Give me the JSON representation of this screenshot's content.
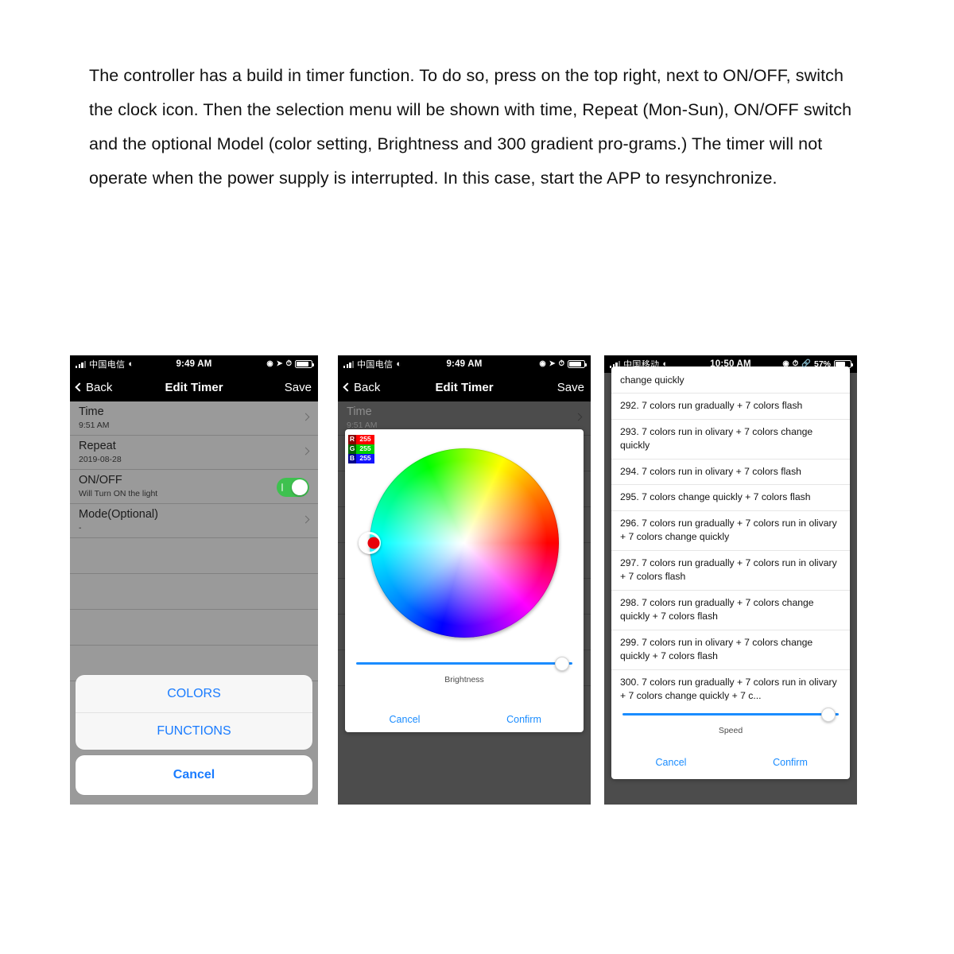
{
  "instructions": {
    "paragraph": "The controller has a build in timer function. To do so, press on the top right, next to ON/OFF, switch the clock icon. Then the selection menu will be shown with time, Repeat (Mon-Sun), ON/OFF switch and the optional Model (color setting, Brightness and 300 gradient pro-grams.) The timer will not operate when the power supply is interrupted. In this case, start the APP to resynchronize."
  },
  "phone1": {
    "statusbar": {
      "carrier": "中国电信",
      "wifi_icon": "wifi-icon",
      "time": "9:49 AM",
      "icons": [
        "do-not-disturb-icon",
        "location-arrow-icon",
        "alarm-clock-icon"
      ],
      "battery_level": "",
      "battery_fill_pct": 72
    },
    "navbar": {
      "back": "Back",
      "title": "Edit Timer",
      "save": "Save"
    },
    "rows": [
      {
        "title": "Time",
        "sub": "9:51 AM",
        "accessory": "chevron"
      },
      {
        "title": "Repeat",
        "sub": "2019-08-28",
        "accessory": "chevron"
      },
      {
        "title": "ON/OFF",
        "sub": "Will Turn ON the light",
        "accessory": "toggle",
        "toggle_on": true
      },
      {
        "title": "Mode(Optional)",
        "sub": "-",
        "accessory": "chevron"
      }
    ],
    "empty_rows": 4,
    "action_sheet": {
      "options": [
        "COLORS",
        "FUNCTIONS"
      ],
      "cancel": "Cancel"
    }
  },
  "phone2": {
    "statusbar": {
      "carrier": "中国电信",
      "wifi_icon": "wifi-icon",
      "time": "9:49 AM",
      "icons": [
        "do-not-disturb-icon",
        "location-arrow-icon",
        "alarm-clock-icon"
      ],
      "battery_fill_pct": 72
    },
    "navbar": {
      "back": "Back",
      "title": "Edit Timer",
      "save": "Save"
    },
    "rows": [
      {
        "title": "Time",
        "sub": "9:51 AM",
        "accessory": "chevron"
      }
    ],
    "color_dialog": {
      "rgb": {
        "r_key": "R",
        "r_val": "255",
        "g_key": "G",
        "g_val": "255",
        "b_key": "B",
        "b_val": "255"
      },
      "wheel_name": "hsv-color-wheel",
      "slider_label": "Brightness",
      "slider_value_pct": 100,
      "cancel": "Cancel",
      "confirm": "Confirm"
    }
  },
  "phone3": {
    "statusbar": {
      "carrier": "中国移动",
      "wifi_icon": "wifi-icon",
      "time": "10:50 AM",
      "icons": [
        "do-not-disturb-icon",
        "alarm-clock-icon",
        "bluetooth-icon"
      ],
      "battery_level": "57%",
      "battery_fill_pct": 57
    },
    "functions_dialog": {
      "partial_item": "change quickly",
      "items": [
        "292. 7 colors run gradually + 7 colors flash",
        "293. 7 colors run in olivary + 7 colors change quickly",
        "294. 7 colors run in olivary + 7 colors flash",
        "295. 7 colors change quickly + 7 colors flash",
        "296. 7 colors run gradually + 7 colors run in olivary + 7 colors change quickly",
        "297. 7 colors run gradually + 7 colors run in olivary + 7 colors flash",
        "298. 7 colors run gradually + 7 colors change quickly + 7 colors flash",
        "299. 7 colors run in olivary + 7 colors change quickly + 7 colors flash",
        "300. 7 colors run gradually + 7 colors run in olivary + 7 colors change quickly + 7 c..."
      ],
      "slider_label": "Speed",
      "slider_value_pct": 100,
      "cancel": "Cancel",
      "confirm": "Confirm"
    }
  },
  "colors": {
    "ios_blue": "#1a8cff",
    "toggle_green": "#3ec14f",
    "dim_gray": "#9a9a9a",
    "dark_gray": "#4c4c4c"
  }
}
